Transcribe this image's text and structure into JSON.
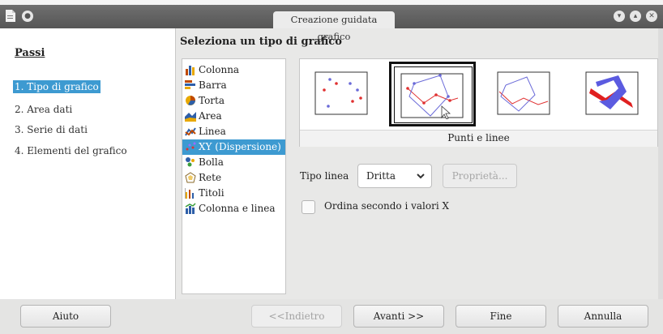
{
  "window": {
    "title": "Creazione guidata grafico"
  },
  "steps": {
    "title": "Passi",
    "items": [
      "1. Tipo di grafico",
      "2. Area dati",
      "3. Serie di dati",
      "4. Elementi del grafico"
    ]
  },
  "chart_type": {
    "title": "Seleziona un tipo di grafico",
    "items": [
      {
        "label": "Colonna",
        "icon": "column-chart-icon"
      },
      {
        "label": "Barra",
        "icon": "bar-chart-icon"
      },
      {
        "label": "Torta",
        "icon": "pie-chart-icon"
      },
      {
        "label": "Area",
        "icon": "area-chart-icon"
      },
      {
        "label": "Linea",
        "icon": "line-chart-icon"
      },
      {
        "label": "XY (Dispersione)",
        "icon": "scatter-chart-icon"
      },
      {
        "label": "Bolla",
        "icon": "bubble-chart-icon"
      },
      {
        "label": "Rete",
        "icon": "net-chart-icon"
      },
      {
        "label": "Titoli",
        "icon": "stock-chart-icon"
      },
      {
        "label": "Colonna e linea",
        "icon": "column-line-chart-icon"
      }
    ],
    "selected": "XY (Dispersione)",
    "variant_selected": "Punti e linee"
  },
  "options": {
    "line_type_label": "Tipo linea",
    "line_type_value": "Dritta",
    "properties_button": "Proprietà...",
    "sort_checkbox_label": "Ordina secondo i valori X",
    "sort_checked": false
  },
  "buttons": {
    "help": "Aiuto",
    "back": "<<Indietro",
    "next": "Avanti >>",
    "finish": "Fine",
    "cancel": "Annulla"
  },
  "colors": {
    "selection": "#3d9ad1",
    "accent_red": "#e03030",
    "accent_blue": "#6a6ad8"
  }
}
